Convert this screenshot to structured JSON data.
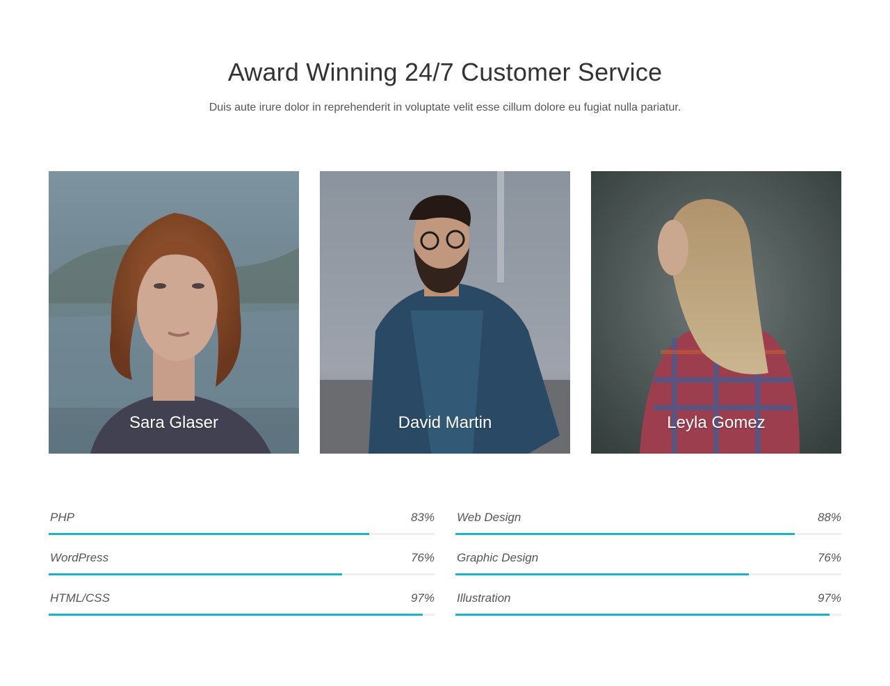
{
  "header": {
    "title": "Award Winning 24/7 Customer Service",
    "subtitle": "Duis aute irure dolor in reprehenderit in voluptate velit esse cillum dolore eu fugiat nulla pariatur."
  },
  "team": [
    {
      "name": "Sara Glaser"
    },
    {
      "name": "David Martin"
    },
    {
      "name": "Leyla Gomez"
    }
  ],
  "skills": {
    "left": [
      {
        "label": "PHP",
        "percent_text": "83%",
        "value": 83
      },
      {
        "label": "WordPress",
        "percent_text": "76%",
        "value": 76
      },
      {
        "label": "HTML/CSS",
        "percent_text": "97%",
        "value": 97
      }
    ],
    "right": [
      {
        "label": "Web Design",
        "percent_text": "88%",
        "value": 88
      },
      {
        "label": "Graphic Design",
        "percent_text": "76%",
        "value": 76
      },
      {
        "label": "Illustration",
        "percent_text": "97%",
        "value": 97
      }
    ]
  },
  "colors": {
    "accent": "#19b4cc",
    "track": "#efefef"
  }
}
